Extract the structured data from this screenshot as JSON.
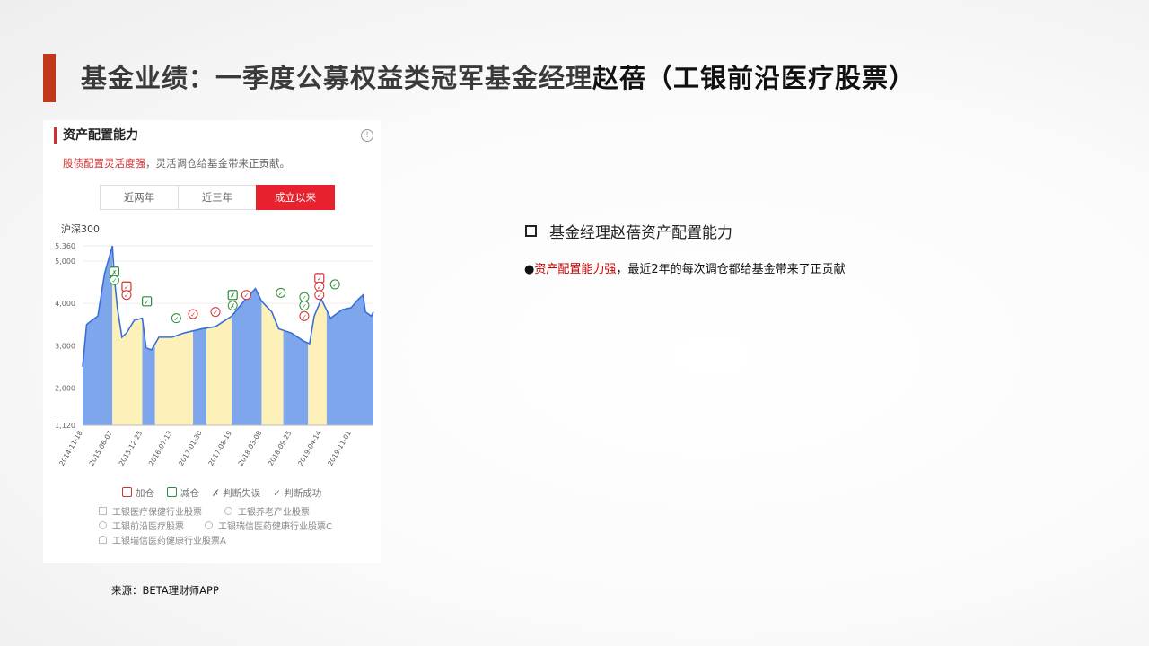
{
  "header": {
    "title_main": "基金业绩：一季度公募权益类冠军基金经理",
    "title_name": "赵蓓（工银前沿医疗股票）"
  },
  "panel": {
    "title": "资产配置能力",
    "info_icon": "info-icon",
    "sub_red": "股债配置灵活度强",
    "sub_rest": "，灵活调仓给基金带来正贡献。",
    "tabs": [
      "近两年",
      "近三年",
      "成立以来"
    ],
    "active_tab": 2,
    "chart_label": "沪深300",
    "legend": {
      "add": "加仓",
      "reduce": "减仓",
      "wrong": "判断失误",
      "right": "判断成功",
      "funds": [
        "工银医疗保健行业股票",
        "工银养老产业股票",
        "工银前沿医疗股票",
        "工银瑞信医药健康行业股票C",
        "工银瑞信医药健康行业股票A"
      ]
    }
  },
  "right": {
    "heading": "基金经理赵蓓资产配置能力",
    "line_red": "资产配置能力强",
    "line_rest": "，最近2年的每次调仓都给基金带来了正贡献"
  },
  "source": "来源：BETA理财师APP",
  "colors": {
    "accent": "#c0391b",
    "line": "#3a6fd6",
    "blue_band": "#7ea6ec",
    "yellow_band": "#fdf0b8",
    "add_red": "#d32f2f",
    "reduce_green": "#2e8b3a"
  },
  "chart_data": {
    "type": "area",
    "title": "",
    "series": [
      {
        "name": "沪深300",
        "x": [
          "2014-11-18",
          "2014-12-15",
          "2015-01-20",
          "2015-03-01",
          "2015-04-15",
          "2015-06-07",
          "2015-06-20",
          "2015-07-10",
          "2015-08-10",
          "2015-09-10",
          "2015-11-01",
          "2015-12-25",
          "2016-01-20",
          "2016-02-25",
          "2016-04-15",
          "2016-07-13",
          "2016-10-01",
          "2017-01-30",
          "2017-05-01",
          "2017-08-19",
          "2017-11-20",
          "2018-01-25",
          "2018-03-08",
          "2018-05-15",
          "2018-07-01",
          "2018-09-25",
          "2018-12-20",
          "2019-01-25",
          "2019-02-25",
          "2019-04-14",
          "2019-06-15",
          "2019-09-01",
          "2019-11-01",
          "2019-12-20",
          "2020-01-20",
          "2020-02-05",
          "2020-03-15",
          "2020-03-30"
        ],
        "y": [
          2500,
          3500,
          3600,
          3700,
          4700,
          5360,
          4600,
          3900,
          3200,
          3300,
          3600,
          3650,
          2950,
          2900,
          3200,
          3200,
          3300,
          3400,
          3450,
          3700,
          4100,
          4350,
          4050,
          3800,
          3400,
          3300,
          3100,
          3050,
          3700,
          4100,
          3650,
          3850,
          3900,
          4100,
          4200,
          3800,
          3700,
          3800
        ]
      }
    ],
    "bands": [
      {
        "from": "2014-11-18",
        "to": "2015-06-07",
        "fill": "blue"
      },
      {
        "from": "2015-06-07",
        "to": "2015-12-25",
        "fill": "yellow"
      },
      {
        "from": "2015-12-25",
        "to": "2016-03-20",
        "fill": "blue"
      },
      {
        "from": "2016-03-20",
        "to": "2016-12-01",
        "fill": "yellow"
      },
      {
        "from": "2016-12-01",
        "to": "2017-03-01",
        "fill": "blue"
      },
      {
        "from": "2017-03-01",
        "to": "2017-08-19",
        "fill": "yellow"
      },
      {
        "from": "2017-08-19",
        "to": "2018-03-08",
        "fill": "blue"
      },
      {
        "from": "2018-03-08",
        "to": "2018-08-01",
        "fill": "yellow"
      },
      {
        "from": "2018-08-01",
        "to": "2019-01-15",
        "fill": "blue"
      },
      {
        "from": "2019-01-15",
        "to": "2019-05-20",
        "fill": "yellow"
      },
      {
        "from": "2019-05-20",
        "to": "2020-03-30",
        "fill": "blue"
      }
    ],
    "markers": [
      {
        "date": "2015-06-20",
        "y": 4750,
        "kind": "reduce",
        "shape": "square",
        "mark": "wrong"
      },
      {
        "date": "2015-06-20",
        "y": 4550,
        "kind": "reduce",
        "shape": "circle",
        "mark": "right"
      },
      {
        "date": "2015-09-10",
        "y": 4400,
        "kind": "add",
        "shape": "square",
        "mark": "right"
      },
      {
        "date": "2015-09-10",
        "y": 4200,
        "kind": "add",
        "shape": "circle",
        "mark": "right"
      },
      {
        "date": "2016-01-25",
        "y": 4050,
        "kind": "reduce",
        "shape": "square",
        "mark": "right"
      },
      {
        "date": "2016-08-10",
        "y": 3650,
        "kind": "reduce",
        "shape": "circle",
        "mark": "right"
      },
      {
        "date": "2016-12-01",
        "y": 3750,
        "kind": "add",
        "shape": "circle",
        "mark": "right"
      },
      {
        "date": "2017-05-01",
        "y": 3800,
        "kind": "add",
        "shape": "circle",
        "mark": "right"
      },
      {
        "date": "2017-08-25",
        "y": 4200,
        "kind": "reduce",
        "shape": "square",
        "mark": "wrong"
      },
      {
        "date": "2017-08-25",
        "y": 3950,
        "kind": "reduce",
        "shape": "circle",
        "mark": "wrong"
      },
      {
        "date": "2017-11-25",
        "y": 4200,
        "kind": "add",
        "shape": "circle",
        "mark": "right"
      },
      {
        "date": "2018-07-15",
        "y": 4250,
        "kind": "reduce",
        "shape": "circle",
        "mark": "right"
      },
      {
        "date": "2018-12-20",
        "y": 4150,
        "kind": "reduce",
        "shape": "circle",
        "mark": "right"
      },
      {
        "date": "2018-12-20",
        "y": 3950,
        "kind": "reduce",
        "shape": "circle",
        "mark": "right"
      },
      {
        "date": "2018-12-20",
        "y": 3700,
        "kind": "add",
        "shape": "circle",
        "mark": "right"
      },
      {
        "date": "2019-04-01",
        "y": 4600,
        "kind": "add",
        "shape": "square",
        "mark": "right"
      },
      {
        "date": "2019-04-01",
        "y": 4400,
        "kind": "add",
        "shape": "circle",
        "mark": "right"
      },
      {
        "date": "2019-04-01",
        "y": 4200,
        "kind": "add",
        "shape": "circle",
        "mark": "right"
      },
      {
        "date": "2019-07-15",
        "y": 4450,
        "kind": "reduce",
        "shape": "circle",
        "mark": "right"
      }
    ],
    "x_ticks": [
      "2014-11-18",
      "2015-06-07",
      "2015-12-25",
      "2016-07-13",
      "2017-01-30",
      "2017-08-19",
      "2018-03-08",
      "2018-09-25",
      "2019-04-14",
      "2019-11-01"
    ],
    "y_ticks": [
      "1,120",
      "2,000",
      "3,000",
      "4,000",
      "5,000",
      "5,360"
    ],
    "ylim": [
      1120,
      5360
    ],
    "xlim": [
      "2014-11-18",
      "2020-03-30"
    ],
    "grid": true,
    "legend_position": "bottom"
  }
}
